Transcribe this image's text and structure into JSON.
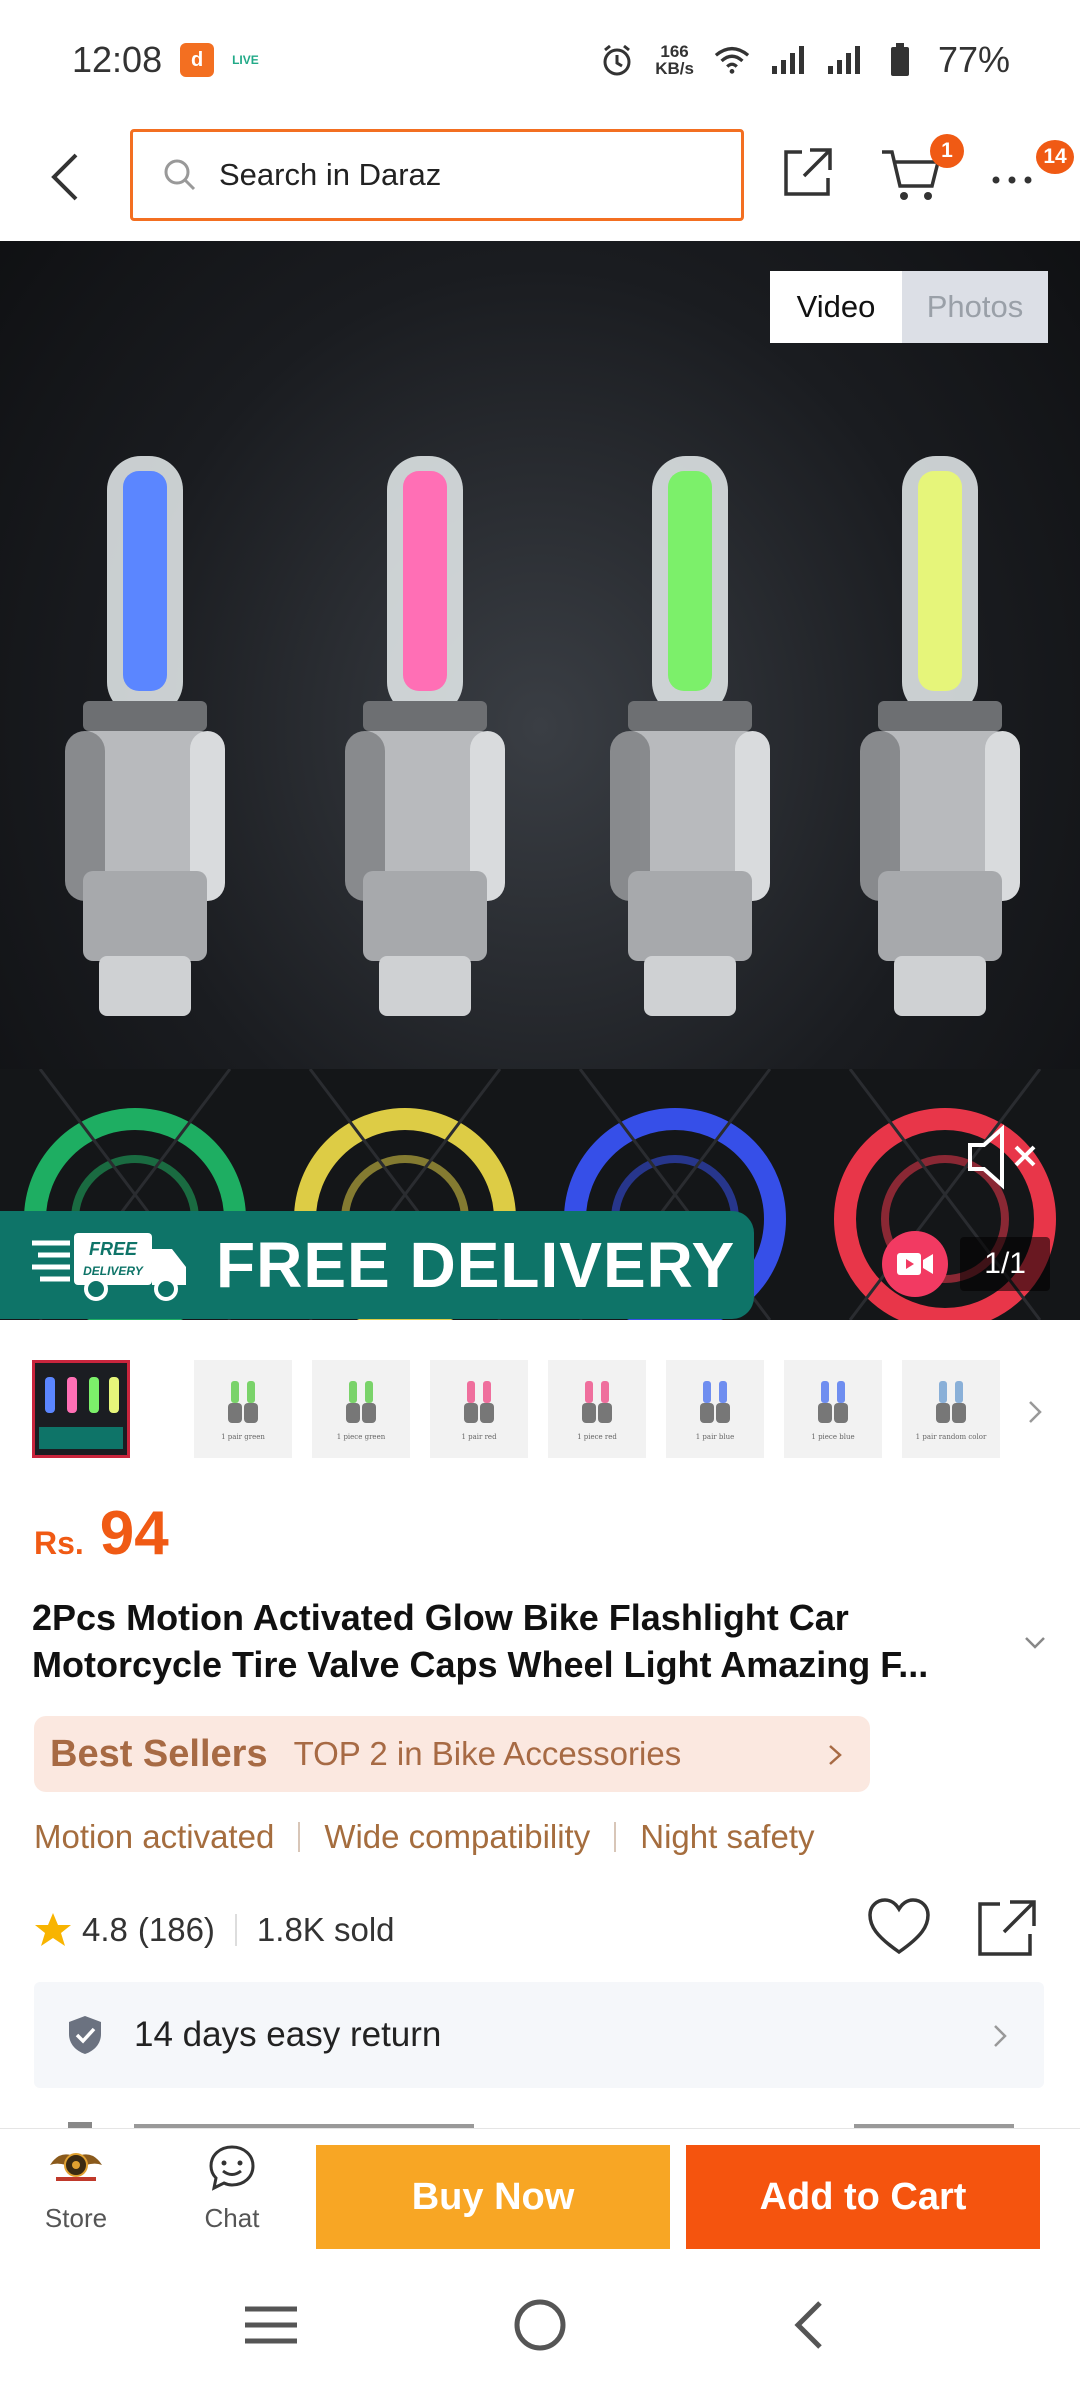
{
  "status_bar": {
    "time": "12:08",
    "app_badge": "d",
    "live_label": "LIVE",
    "speed_value": "166",
    "speed_unit": "KB/s",
    "battery": "77%"
  },
  "header": {
    "search_placeholder": "Search in Daraz",
    "cart_badge": "1",
    "more_badge": "14",
    "icons": [
      "back-icon",
      "search-icon",
      "share-icon",
      "cart-icon",
      "more-icon"
    ]
  },
  "media": {
    "tabs": [
      "Video",
      "Photos"
    ],
    "active_tab": "Video",
    "banner_text": "FREE DELIVERY",
    "banner_badge_line1": "FREE",
    "banner_badge_line2": "DELIVERY",
    "counter": "1/1",
    "bulb_colors": [
      "#5b86ff",
      "#ff6fb5",
      "#7cf06a",
      "#e6f57a"
    ],
    "wheel_colors": [
      "#1fbf6a",
      "#f3e04a",
      "#3a55ff",
      "#ff3a4f"
    ]
  },
  "thumbnails": [
    {
      "caption": "",
      "active": true
    },
    {
      "caption": "1 pair green",
      "color": "#7ad36a"
    },
    {
      "caption": "1 piece green",
      "color": "#7ad36a"
    },
    {
      "caption": "1 pair red",
      "color": "#ef6f9d"
    },
    {
      "caption": "1 piece red",
      "color": "#ef6f9d"
    },
    {
      "caption": "1 pair blue",
      "color": "#6f8ef0"
    },
    {
      "caption": "1 piece blue",
      "color": "#6f8ef0"
    },
    {
      "caption": "1 pair random color",
      "color": "#8ab0d8"
    }
  ],
  "product": {
    "currency": "Rs.",
    "price": "94",
    "title": "2Pcs Motion Activated Glow Bike Flashlight Car Motorcycle Tire Valve Caps Wheel Light Amazing F...",
    "best_sellers_label": "Best Sellers",
    "best_sellers_rank": "TOP 2 in Bike Accessories",
    "features": [
      "Motion activated",
      "Wide compatibility",
      "Night safety"
    ],
    "rating": "4.8",
    "rating_count": "(186)",
    "sold": "1.8K sold",
    "return_policy": "14 days easy return"
  },
  "action_bar": {
    "store_label": "Store",
    "chat_label": "Chat",
    "buy_now": "Buy Now",
    "add_to_cart": "Add to Cart"
  },
  "colors": {
    "accent": "#f36f21",
    "buy_now": "#f8a624",
    "add_to_cart": "#f5540e",
    "price": "#f05a14",
    "free_delivery": "#0e7468",
    "best_sellers_bg": "#fbe8e0"
  }
}
